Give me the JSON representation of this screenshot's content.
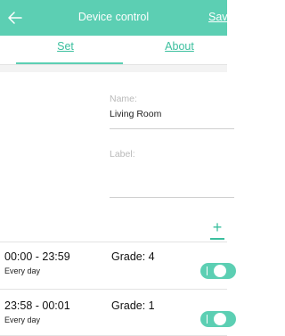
{
  "header": {
    "title": "Device control",
    "save_label": "Save",
    "accent_color": "#5ccfb3",
    "back_icon": "arrow-left-icon"
  },
  "tabs": [
    {
      "label": "Set",
      "active": true
    },
    {
      "label": "About",
      "active": false
    }
  ],
  "form": {
    "name_label": "Name:",
    "name_value": "Living Room",
    "label_label": "Label:",
    "label_value": ""
  },
  "add_button": {
    "icon": "plus-icon",
    "label": "+"
  },
  "schedules": [
    {
      "time_range": "00:00 - 23:59",
      "days": "Every day",
      "grade": "Grade: 4",
      "enabled": true
    },
    {
      "time_range": "23:58 - 00:01",
      "days": "Every day",
      "grade": "Grade: 1",
      "enabled": true
    }
  ]
}
